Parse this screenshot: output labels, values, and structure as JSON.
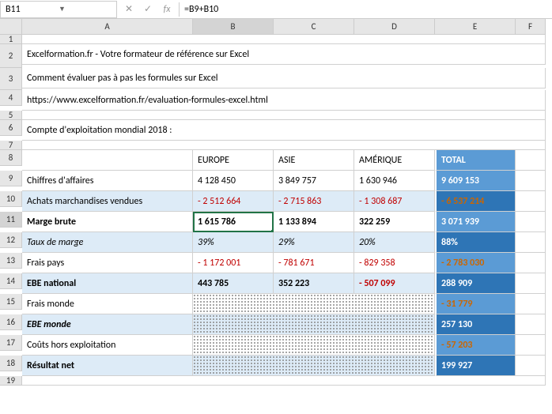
{
  "nameBox": "B11",
  "formula": "=B9+B10",
  "columns": [
    "A",
    "B",
    "C",
    "D",
    "E",
    "F"
  ],
  "rows": [
    "1",
    "2",
    "3",
    "4",
    "5",
    "6",
    "7",
    "8",
    "9",
    "10",
    "11",
    "12",
    "13",
    "14",
    "15",
    "16",
    "17",
    "18",
    "19"
  ],
  "title": "Excelformation.fr - Votre formateur de référence sur Excel",
  "subtitle": "Comment évaluer pas à pas les formules sur Excel",
  "link": "https://www.excelformation.fr/evaluation-formules-excel.html",
  "section": "Compte d'exploitation mondial 2018 :",
  "headers": {
    "b": "EUROPE",
    "c": "ASIE",
    "d": "AMÉRIQUE",
    "e": "TOTAL"
  },
  "r9": {
    "label": "Chiffres d'affaires",
    "b": "4 128 450",
    "c": "3 849 757",
    "d": "1 630 946",
    "e": "9 609 153"
  },
  "r10": {
    "label": "Achats marchandises vendues",
    "b": "- 2 512 664",
    "c": "- 2 715 863",
    "d": "- 1 308 687",
    "e": "- 6 537 214"
  },
  "r11": {
    "label": "Marge brute",
    "b": "1 615 786",
    "c": "1 133 894",
    "d": "322 259",
    "e": "3 071 939"
  },
  "r12": {
    "label": "Taux de marge",
    "b": "39%",
    "c": "29%",
    "d": "20%",
    "e": "88%"
  },
  "r13": {
    "label": "Frais pays",
    "b": "- 1 172 001",
    "c": "- 781 671",
    "d": "- 829 358",
    "e": "- 2 783 030"
  },
  "r14": {
    "label": "EBE national",
    "b": "443 785",
    "c": "352 223",
    "d": "- 507 099",
    "e": "288 909"
  },
  "r15": {
    "label": "Frais monde",
    "e": "- 31 779"
  },
  "r16": {
    "label": "EBE monde",
    "e": "257 130"
  },
  "r17": {
    "label": "Coûts hors exploitation",
    "e": "- 57 203"
  },
  "r18": {
    "label": "Résultat net",
    "e": "199 927"
  }
}
